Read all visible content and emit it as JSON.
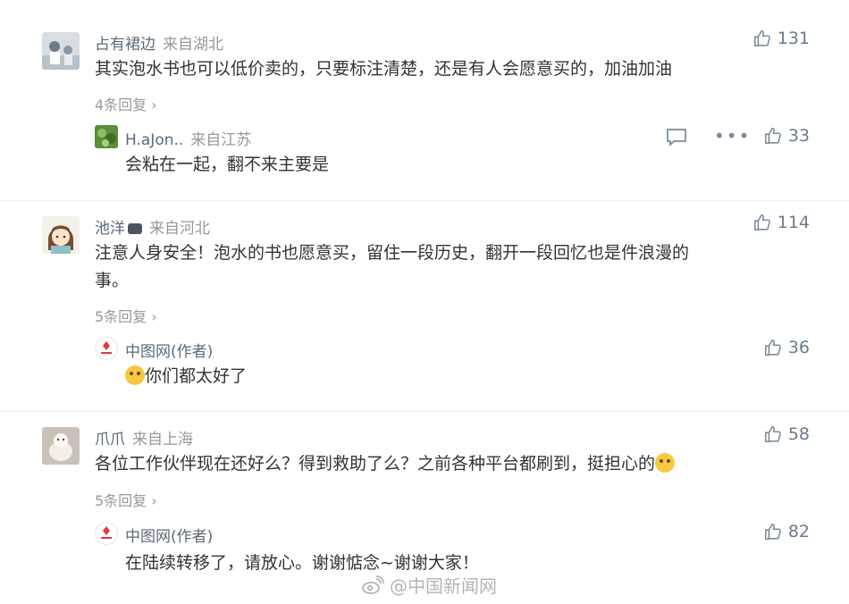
{
  "comments": [
    {
      "user": "占有裙边",
      "location": "来自湖北",
      "text": "其实泡水书也可以低价卖的，只要标注清楚，还是有人会愿意买的，加油加油",
      "likes": "131",
      "more_replies": "4条回复",
      "reply": {
        "user": "H.aJon..",
        "location": "来自江苏",
        "text": "会粘在一起，翻不来主要是",
        "likes": "33"
      }
    },
    {
      "user": "池洋",
      "location": "来自河北",
      "text_line1": "注意人身安全！泡水的书也愿意买，留住一段历史，翻开一段回忆也是件浪漫的",
      "text_line2": "事。",
      "likes": "114",
      "more_replies": "5条回复",
      "reply": {
        "user": "中图网(作者)",
        "text": "你们都太好了",
        "likes": "36"
      }
    },
    {
      "user": "爪爪",
      "location": "来自上海",
      "text": "各位工作伙伴现在还好么？得到救助了么？之前各种平台都刷到，挺担心的",
      "likes": "58",
      "more_replies": "5条回复",
      "reply": {
        "user": "中图网(作者)",
        "text": "在陆续转移了，请放心。谢谢惦念~谢谢大家！",
        "likes": "82"
      }
    }
  ],
  "watermark": "@中国新闻网",
  "colors": {
    "username": "#5a6a7a",
    "meta": "#999999",
    "text": "#333333",
    "like": "#6b7b8c"
  }
}
